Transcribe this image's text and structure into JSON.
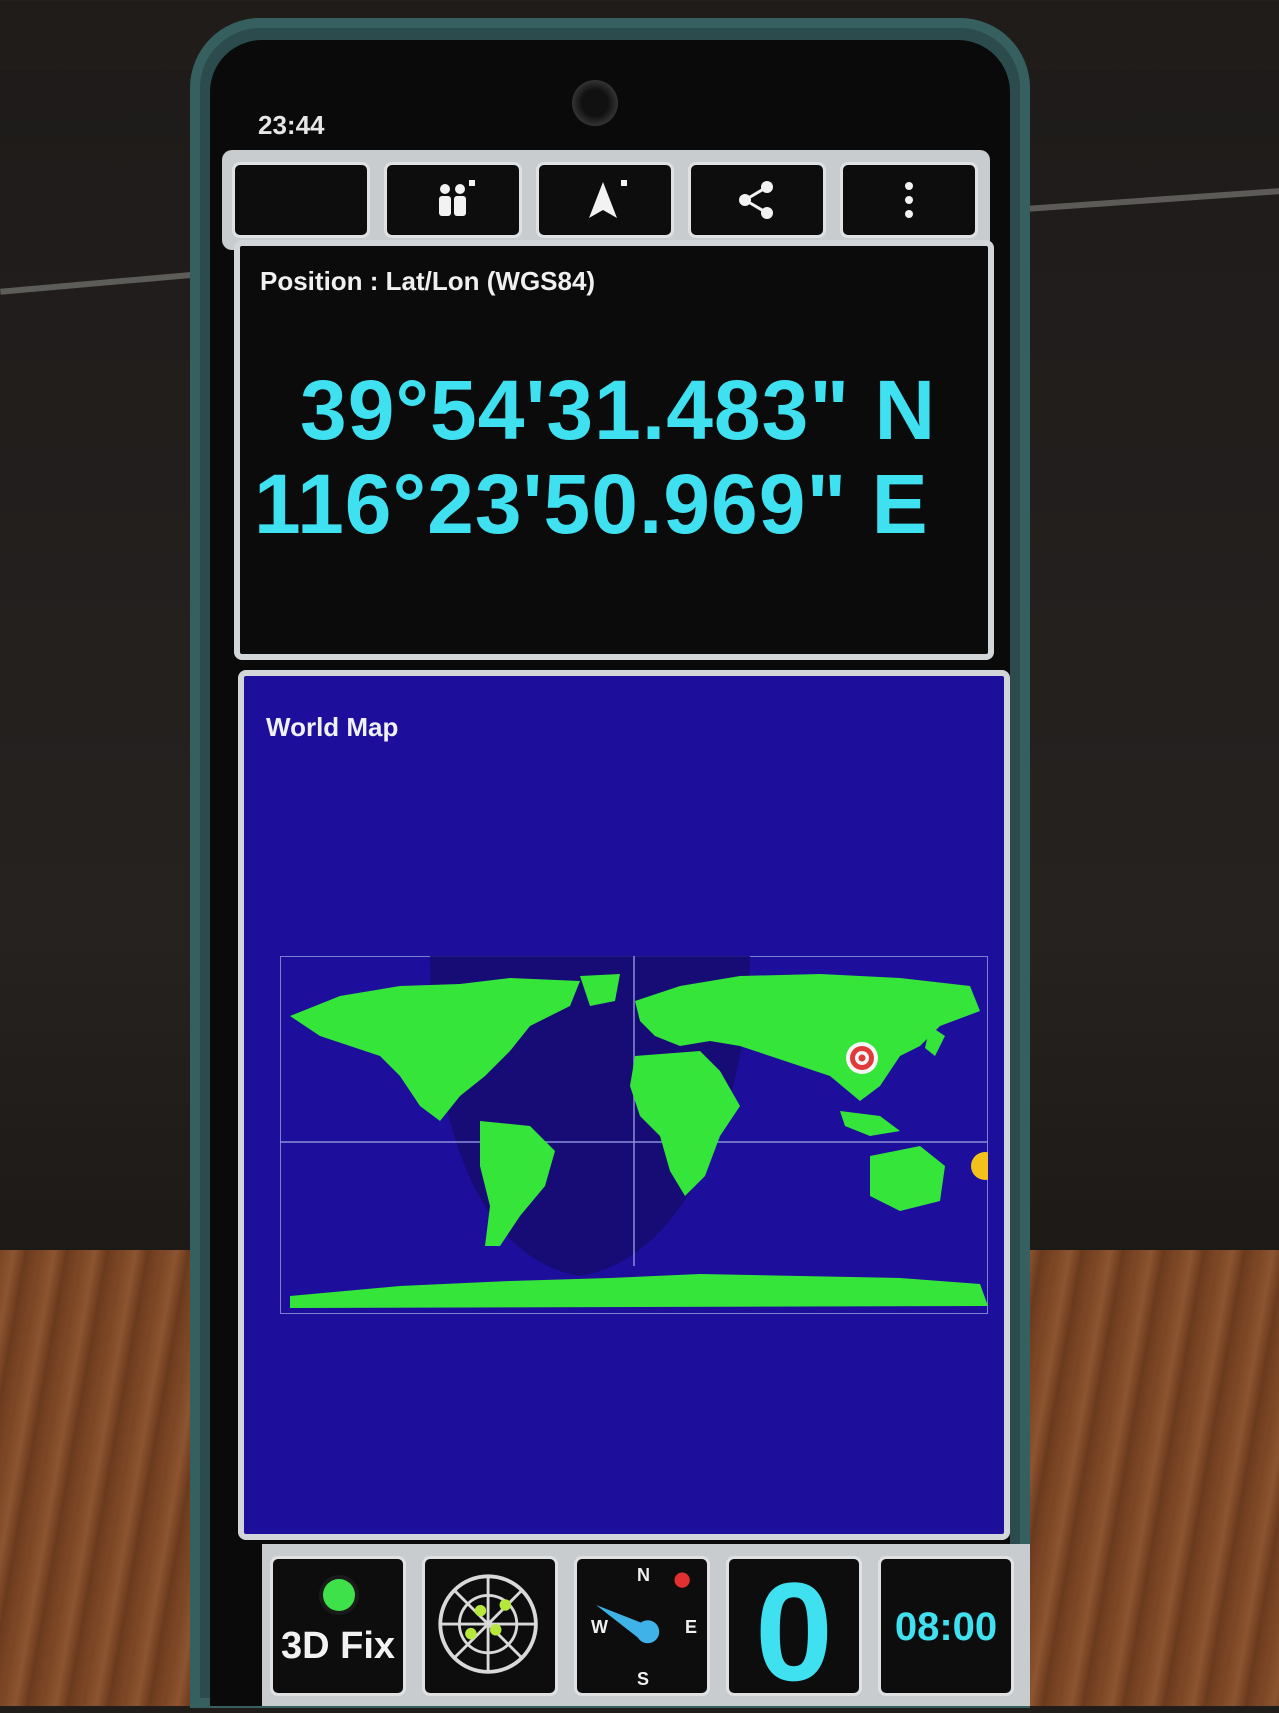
{
  "status_bar": {
    "time": "23:44"
  },
  "toolbar": {
    "buttons": [
      {
        "name": "night-mode",
        "icon": "moon-icon"
      },
      {
        "name": "share-location",
        "icon": "people-icon"
      },
      {
        "name": "navigation",
        "icon": "navigation-arrow-icon"
      },
      {
        "name": "share",
        "icon": "share-icon"
      },
      {
        "name": "more",
        "icon": "more-vertical-icon"
      }
    ]
  },
  "position_panel": {
    "title": "Position : Lat/Lon (WGS84)",
    "latitude": "39°54'31.483\" N",
    "longitude": "116°23'50.969\" E"
  },
  "world_map": {
    "title": "World Map",
    "land_color": "#36e53a",
    "ocean_color": "#1d0f9c",
    "marker": "current-location-marker",
    "sun": "sun-icon"
  },
  "bottom_bar": {
    "fix_status": "3D Fix",
    "fix_color": "#3ee14a",
    "compass": {
      "n": "N",
      "s": "S",
      "e": "E",
      "w": "W"
    },
    "satellites_in_use": "0",
    "time": "08:00",
    "accent": "#3fe0f0"
  }
}
